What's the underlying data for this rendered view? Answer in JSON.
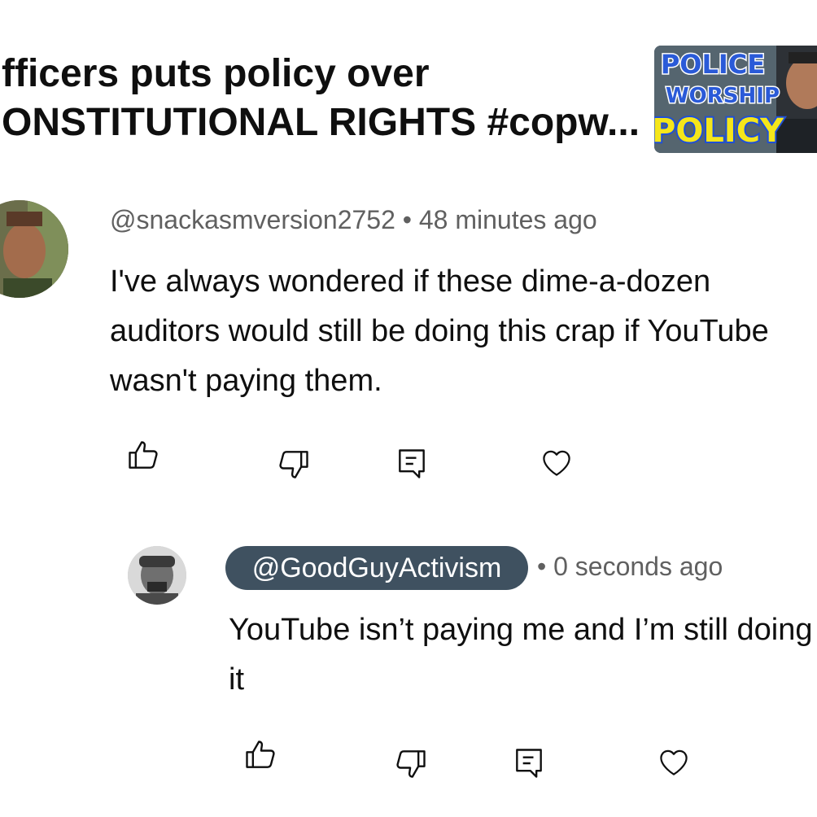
{
  "video": {
    "title_line1": "fficers puts policy over",
    "title_line2": "ONSTITUTIONAL RIGHTS #copw...",
    "thumbnail": {
      "line1": "POLICE",
      "line2": "WORSHIP",
      "line3": "POLICY"
    }
  },
  "comment": {
    "handle": "@snackasmversion2752",
    "separator": "•",
    "time": "48 minutes ago",
    "meta_text": "@snackasmversion2752 • 48 minutes ago",
    "text": "I've always wondered if these dime-a-dozen auditors would still be doing this crap if YouTube wasn't paying them.",
    "actions": [
      "like-icon",
      "dislike-icon",
      "reply-icon",
      "heart-icon"
    ]
  },
  "reply": {
    "handle": "@GoodGuyActivism",
    "meta_text": "• 0 seconds ago",
    "text": "YouTube isn’t paying me and I’m still doing it",
    "actions": [
      "like-icon",
      "dislike-icon",
      "reply-icon",
      "heart-icon"
    ]
  },
  "colors": {
    "text": "#0f0f0f",
    "meta": "#606060",
    "handle_pill": "#3f5160",
    "thumbnail_yellow": "#f5e61a",
    "thumbnail_blue": "#1e4fd8"
  }
}
